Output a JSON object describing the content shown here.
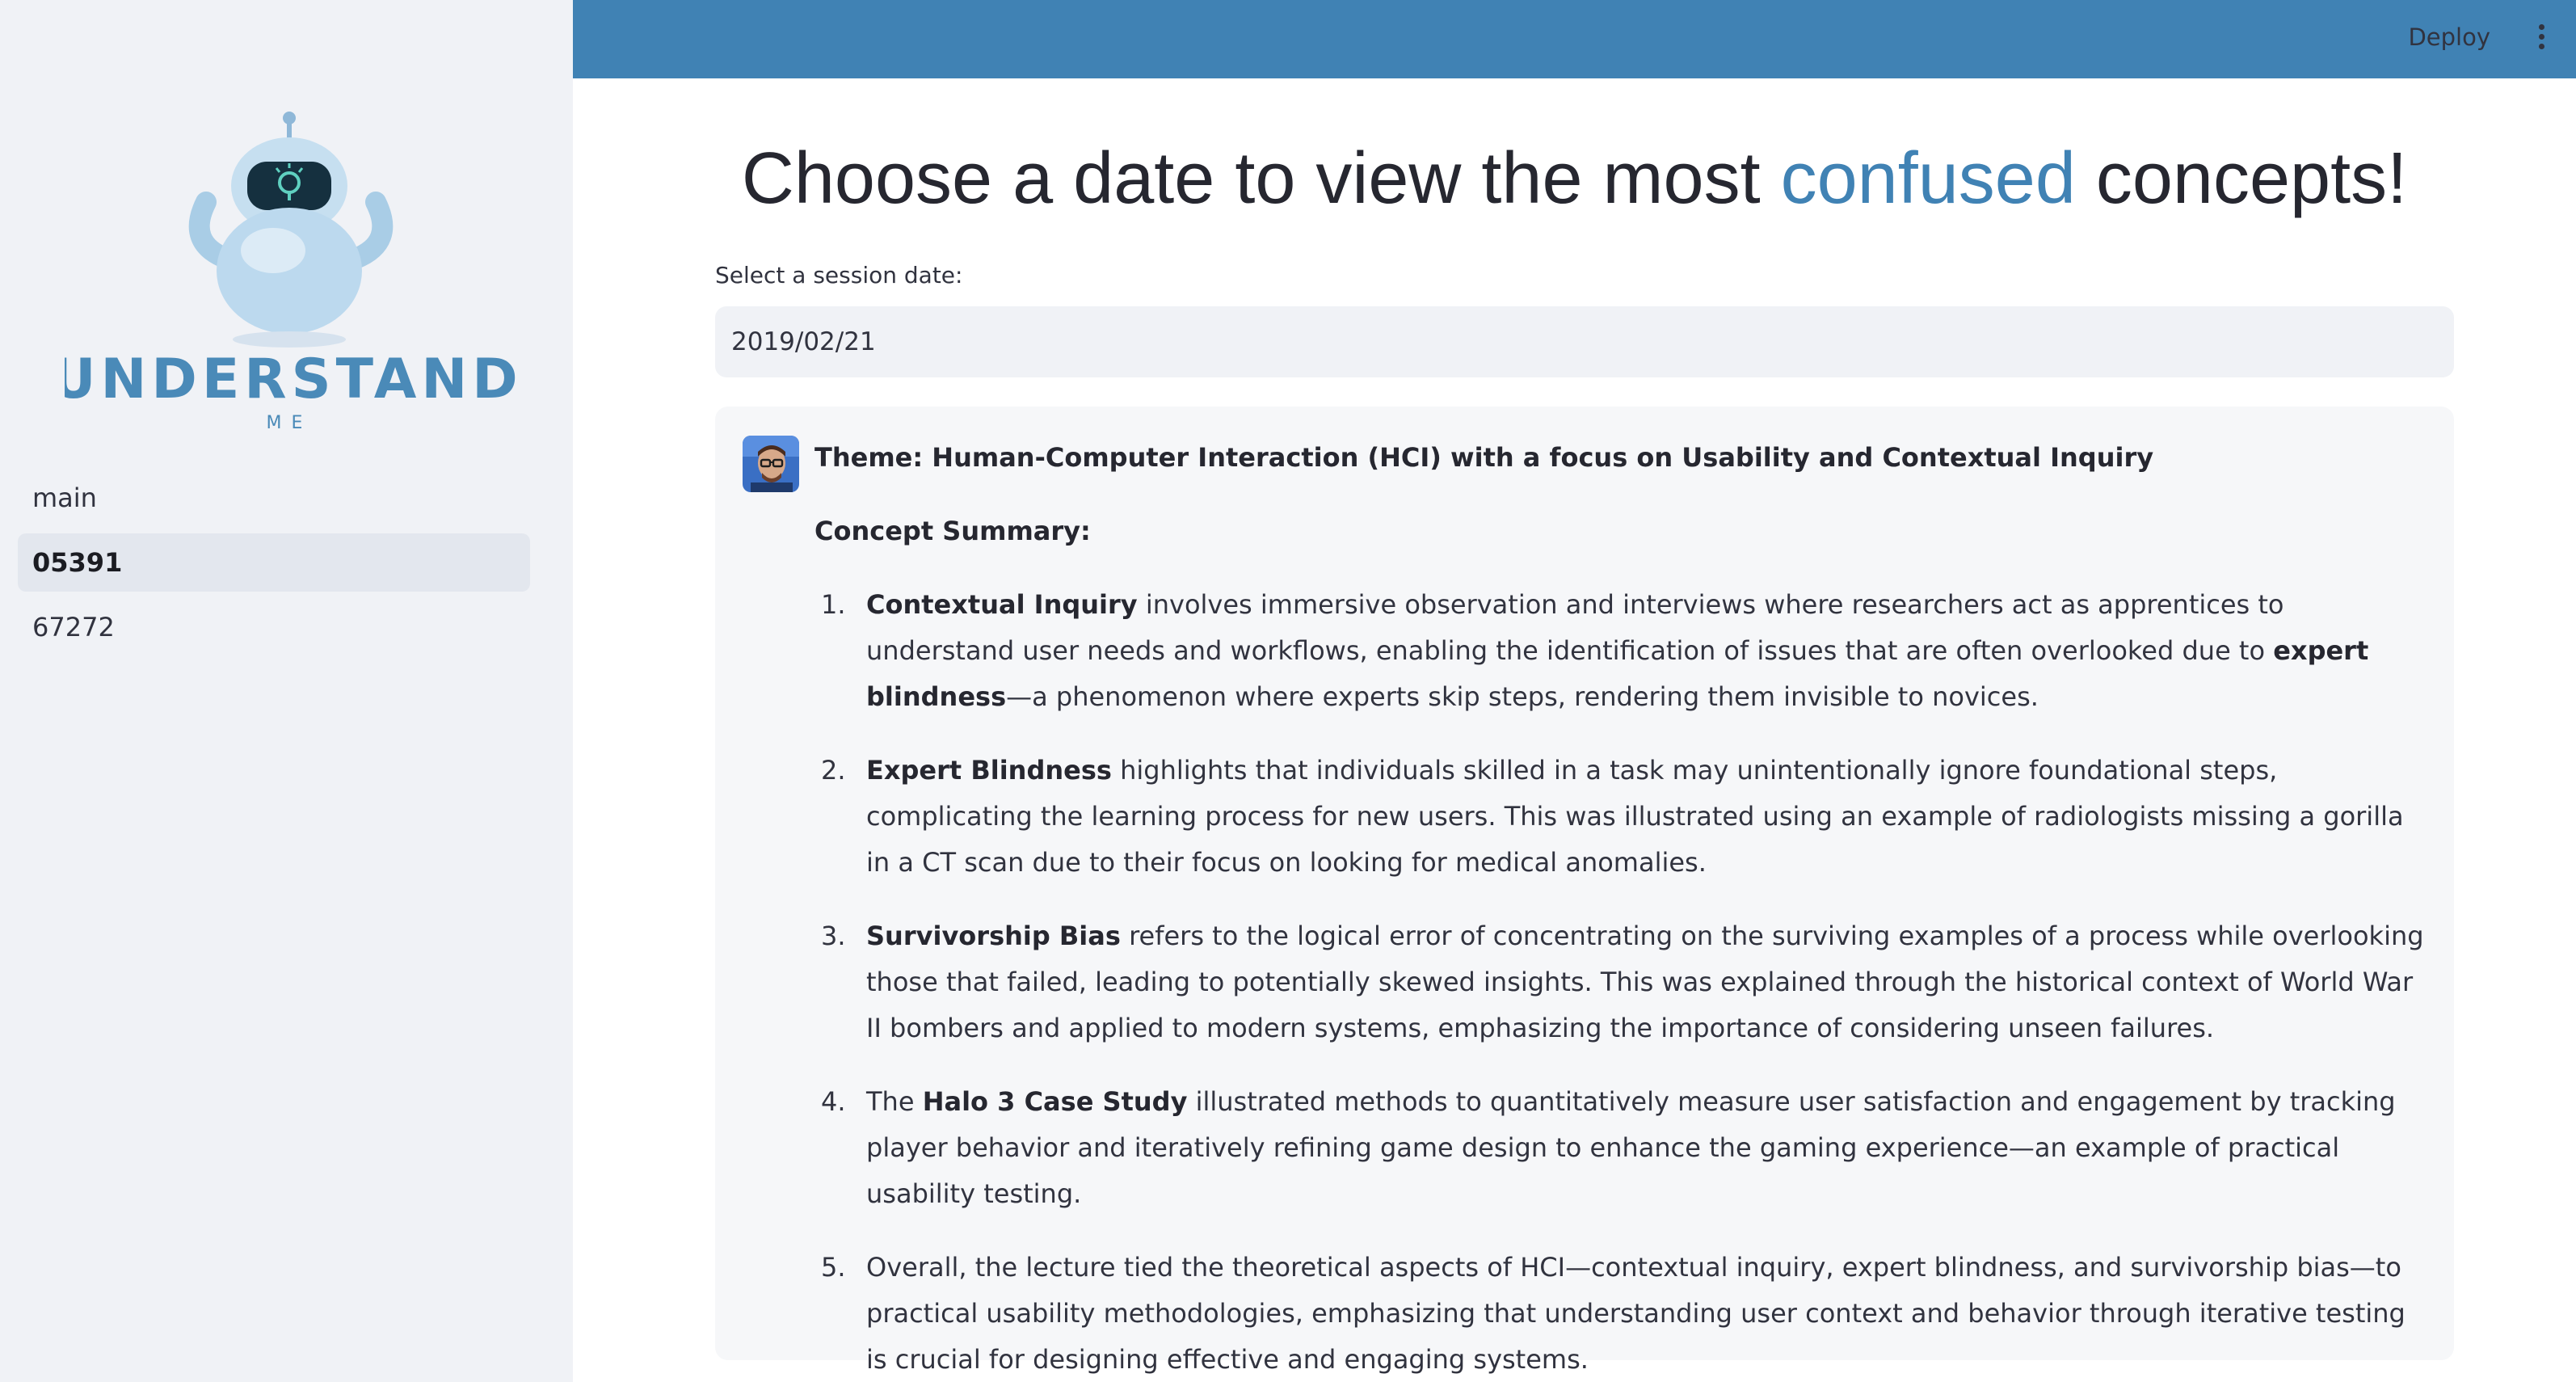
{
  "sidebar": {
    "logo": {
      "text": "UNDERSTAND",
      "subtext": "ME",
      "icon": "robot-lightbulb-logo"
    },
    "items": [
      {
        "label": "main",
        "active": false
      },
      {
        "label": "05391",
        "active": true
      },
      {
        "label": "67272",
        "active": false
      }
    ]
  },
  "header": {
    "deploy_label": "Deploy",
    "menu_icon": "vertical-dots-icon",
    "color": "#4082b4"
  },
  "main": {
    "title_before": "Choose a date to view the most ",
    "title_accent": "confused",
    "title_after": " concepts!",
    "accent_color": "#4082b4",
    "date_label": "Select a session date:",
    "date_value": "2019/02/21"
  },
  "message": {
    "avatar": "lecturer-avatar-icon",
    "theme": "Theme: Human-Computer Interaction (HCI) with a focus on Usability and Contextual Inquiry",
    "summary_title": "Concept Summary:",
    "items": [
      {
        "num": "1.",
        "prefix": "",
        "bold": "Contextual Inquiry",
        "text": " involves immersive observation and interviews where researchers act as apprentices to understand user needs and workflows, enabling the identification of issues that are often overlooked due to ",
        "bold2": "expert blindness",
        "text2": "—a phenomenon where experts skip steps, rendering them invisible to novices."
      },
      {
        "num": "2.",
        "prefix": "",
        "bold": "Expert Blindness",
        "text": " highlights that individuals skilled in a task may unintentionally ignore foundational steps, complicating the learning process for new users. This was illustrated using an example of radiologists missing a gorilla in a CT scan due to their focus on looking for medical anomalies.",
        "bold2": "",
        "text2": ""
      },
      {
        "num": "3.",
        "prefix": "",
        "bold": "Survivorship Bias",
        "text": " refers to the logical error of concentrating on the surviving examples of a process while overlooking those that failed, leading to potentially skewed insights. This was explained through the historical context of World War II bombers and applied to modern systems, emphasizing the importance of considering unseen failures.",
        "bold2": "",
        "text2": ""
      },
      {
        "num": "4.",
        "prefix": "The ",
        "bold": "Halo 3 Case Study",
        "text": " illustrated methods to quantitatively measure user satisfaction and engagement by tracking player behavior and iteratively refining game design to enhance the gaming experience—an example of practical usability testing.",
        "bold2": "",
        "text2": ""
      },
      {
        "num": "5.",
        "prefix": "Overall, the lecture tied the theoretical aspects of HCI—contextual inquiry, expert blindness, and survivorship bias—to practical usability methodologies, emphasizing that understanding user context and behavior through iterative testing is crucial for designing effective and engaging systems.",
        "bold": "",
        "text": "",
        "bold2": "",
        "text2": ""
      }
    ]
  }
}
